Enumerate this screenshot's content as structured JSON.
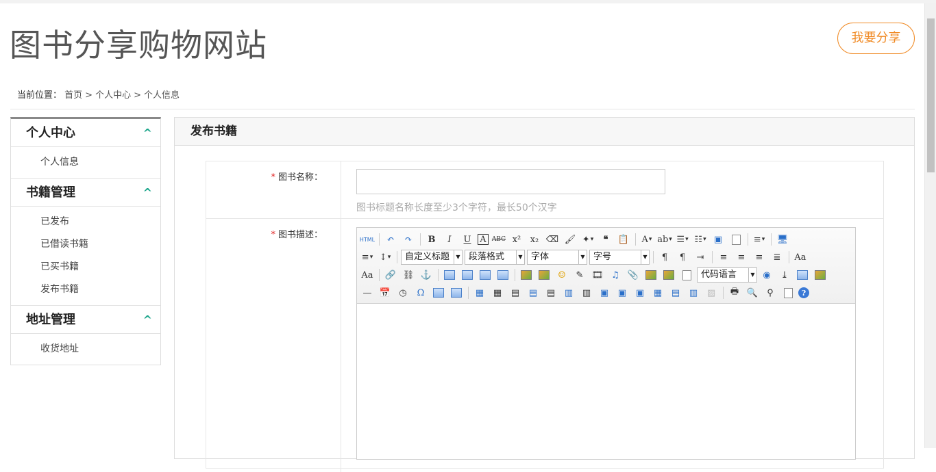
{
  "header": {
    "site_title": "图书分享购物网站",
    "share_button": "我要分享"
  },
  "breadcrumb": {
    "label": "当前位置：",
    "items": [
      "首页",
      "个人中心",
      "个人信息"
    ],
    "separator": ">"
  },
  "sidebar": {
    "sections": [
      {
        "title": "个人中心",
        "items": [
          "个人信息"
        ]
      },
      {
        "title": "书籍管理",
        "items": [
          "已发布",
          "已借读书籍",
          "已买书籍",
          "发布书籍"
        ]
      },
      {
        "title": "地址管理",
        "items": [
          "收货地址"
        ]
      }
    ],
    "chevron": "^"
  },
  "panel": {
    "title": "发布书籍"
  },
  "form": {
    "required_mark": "*",
    "name_label": "图书名称：",
    "name_value": "",
    "name_hint": "图书标题名称长度至少3个字符，最长50个汉字",
    "desc_label": "图书描述："
  },
  "editor": {
    "html_label": "HTML",
    "custom_title_select": "自定义标题",
    "paragraph_select": "段落格式",
    "font_select": "字体",
    "size_select": "字号",
    "code_language_select": "代码语言"
  },
  "colors": {
    "accent_orange": "#f08a24",
    "chevron_green": "#1aa58a",
    "required_red": "#e02020"
  }
}
